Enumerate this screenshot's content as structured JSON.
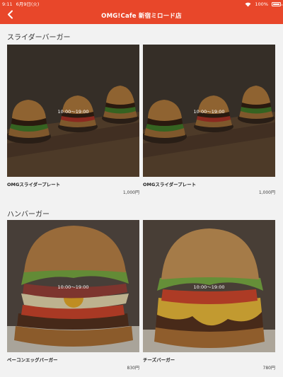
{
  "status_bar": {
    "time": "9:11",
    "date": "6月9日(火)",
    "battery": "100%"
  },
  "nav": {
    "title": "OMG!Cafe 新宿ミロード店",
    "back_icon": "chevron-left-icon"
  },
  "colors": {
    "header": "#e8472a",
    "background": "#f2f2f2"
  },
  "sections": [
    {
      "title": "スライダーバーガー",
      "items": [
        {
          "hours": "10:00〜19:00",
          "name": "OMGスライダープレート",
          "price": "1,000円"
        },
        {
          "hours": "10:00〜19:00",
          "name": "OMGスライダープレート",
          "price": "1,000円"
        }
      ]
    },
    {
      "title": "ハンバーガー",
      "items": [
        {
          "hours": "10:00〜19:00",
          "name": "ベーコンエッグバーガー",
          "price": "830円"
        },
        {
          "hours": "10:00〜19:00",
          "name": "チーズバーガー",
          "price": "780円"
        }
      ]
    }
  ]
}
